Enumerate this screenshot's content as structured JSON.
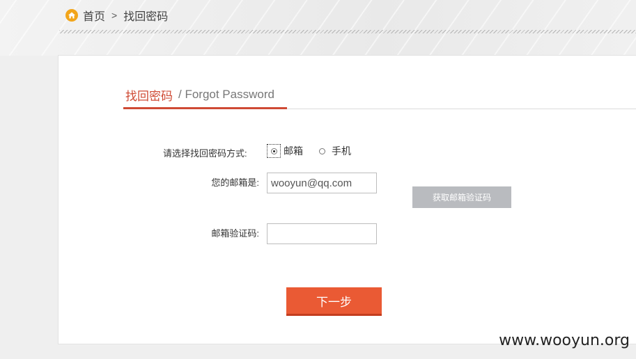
{
  "breadcrumb": {
    "home": "首页",
    "separator": ">",
    "current": "找回密码"
  },
  "title": {
    "cn": "找回密码",
    "en": "/ Forgot Password"
  },
  "form": {
    "method_label": "请选择找回密码方式:",
    "method_options": [
      {
        "label": "邮箱",
        "checked": true
      },
      {
        "label": "手机",
        "checked": false
      }
    ],
    "email_label": "您的邮箱是:",
    "email_value": "wooyun@qq.com",
    "code_label": "邮箱验证码:",
    "code_value": "",
    "get_code_button": "获取邮箱验证码",
    "next_button": "下一步"
  },
  "watermark": "www.wooyun.org",
  "colors": {
    "accent": "#cf4a34",
    "next_button": "#ea5a34",
    "get_code_button": "#b9bbbf",
    "home_icon": "#f2a51a"
  },
  "icons": {
    "home": "home-icon"
  }
}
